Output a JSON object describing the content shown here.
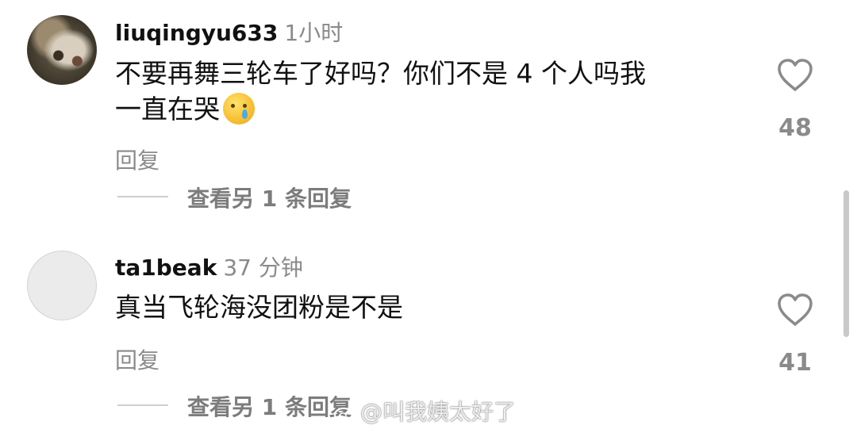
{
  "comments": [
    {
      "username": "liuqingyu633",
      "time": "1小时",
      "text_line1": "不要再舞三轮车了好吗？你们不是 4 个人吗我",
      "text_line2": "一直在哭",
      "emoji": "crying-face-icon",
      "reply_label": "回复",
      "view_replies_label": "查看另 1 条回复",
      "likes": "48"
    },
    {
      "username": "ta1beak",
      "time": "37 分钟",
      "text_line1": "真当飞轮海没团粉是不是",
      "reply_label": "回复",
      "view_replies_label": "查看另 1 条回复",
      "likes": "41"
    }
  ],
  "watermark": "@叫我姨太好了",
  "colors": {
    "text": "#111111",
    "secondary": "#8a8a8a",
    "background": "#ffffff"
  }
}
